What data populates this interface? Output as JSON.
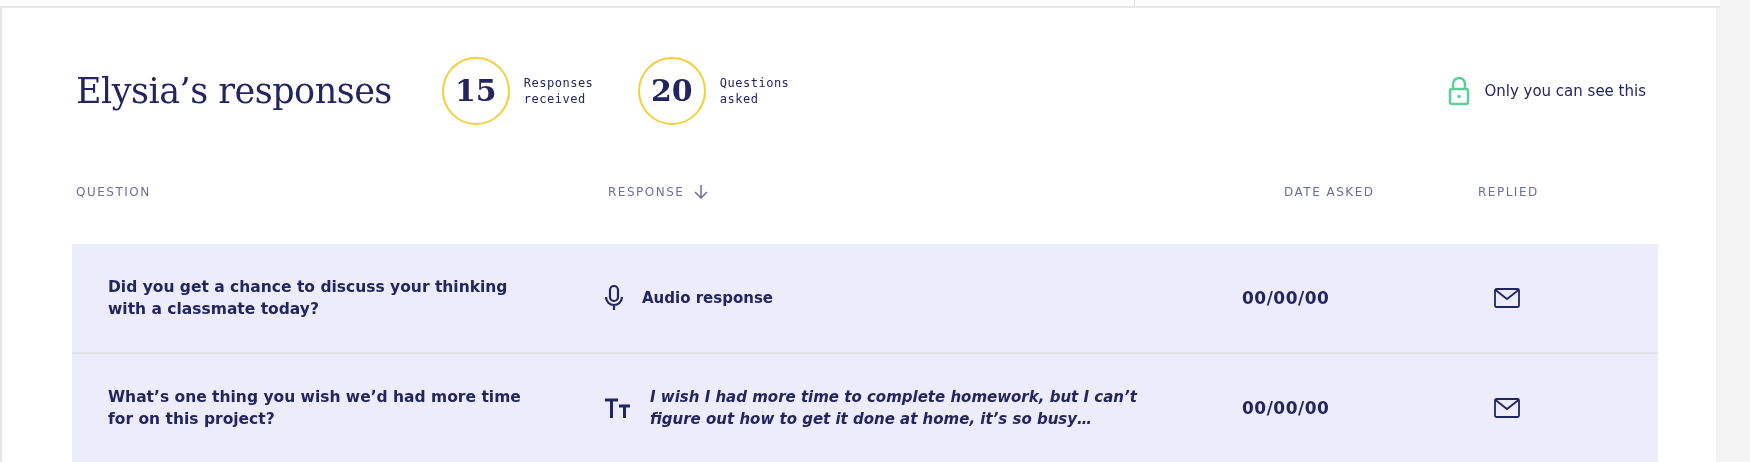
{
  "title": "Elysia’s responses",
  "stats": [
    {
      "value": "15",
      "label": "Responses received"
    },
    {
      "value": "20",
      "label": "Questions asked"
    }
  ],
  "privacy": "Only you can see this",
  "columns": [
    {
      "label": "QUESTION",
      "sorted": false
    },
    {
      "label": "RESPONSE",
      "sorted": true
    },
    {
      "label": "DATE ASKED",
      "sorted": false
    },
    {
      "label": "REPLIED",
      "sorted": false
    }
  ],
  "rows": [
    {
      "question": "Did you get a chance to discuss your thinking with a classmate today?",
      "kind": "audio",
      "response": "Audio response",
      "date": "00/00/00"
    },
    {
      "question": "What’s one thing you wish we’d had more time for on this project?",
      "kind": "text",
      "response": "I wish I had more time to complete homework, but I can’t figure out how to get it done at home, it’s so busy…",
      "date": "00/00/00"
    }
  ]
}
